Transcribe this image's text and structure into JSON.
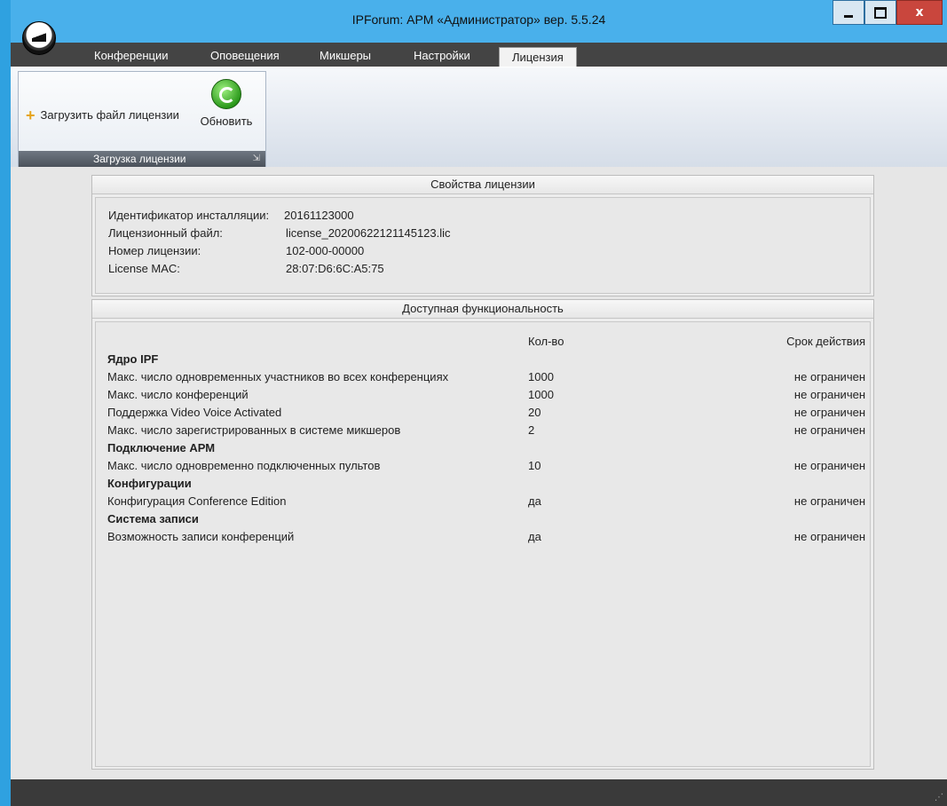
{
  "window": {
    "title": "IPForum: АРМ «Администратор» вер. 5.5.24",
    "controls": {
      "minimize": "minimize",
      "maximize": "maximize",
      "close": "x"
    }
  },
  "tabs": [
    "Конференции",
    "Оповещения",
    "Микшеры",
    "Настройки",
    "Лицензия"
  ],
  "active_tab": "Лицензия",
  "ribbon": {
    "load_license_label": "Загрузить файл лицензии",
    "refresh_label": "Обновить",
    "group_caption": "Загрузка лицензии"
  },
  "license_properties": {
    "header": "Свойства лицензии",
    "rows": [
      {
        "label": "Идентификатор инсталляции:",
        "value": "20161123000"
      },
      {
        "label": "Лицензионный файл:",
        "value": "license_20200622121145123.lic"
      },
      {
        "label": "Номер лицензии:",
        "value": "102-000-00000"
      },
      {
        "label": "License MAC:",
        "value": "28:07:D6:6C:A5:75"
      }
    ]
  },
  "functionality": {
    "header": "Доступная функциональность",
    "col_qty": "Кол-во",
    "col_term": "Срок действия",
    "sections": [
      {
        "title": "Ядро IPF",
        "items": [
          {
            "name": "Макс. число одновременных участников во всех конференциях",
            "qty": "1000",
            "term": "не ограничен"
          },
          {
            "name": "Макс. число конференций",
            "qty": "1000",
            "term": "не ограничен"
          },
          {
            "name": "Поддержка Video Voice Activated",
            "qty": "20",
            "term": "не ограничен"
          },
          {
            "name": "Макс. число зарегистрированных в системе микшеров",
            "qty": "2",
            "term": "не ограничен"
          }
        ]
      },
      {
        "title": "Подключение АРМ",
        "items": [
          {
            "name": "Макс. число одновременно подключенных пультов",
            "qty": "10",
            "term": "не ограничен"
          }
        ]
      },
      {
        "title": "Конфигурации",
        "items": [
          {
            "name": "Конфигурация Conference Edition",
            "qty": "да",
            "term": "не ограничен"
          }
        ]
      },
      {
        "title": "Система записи",
        "items": [
          {
            "name": "Возможность записи конференций",
            "qty": "да",
            "term": "не ограничен"
          }
        ]
      }
    ]
  }
}
